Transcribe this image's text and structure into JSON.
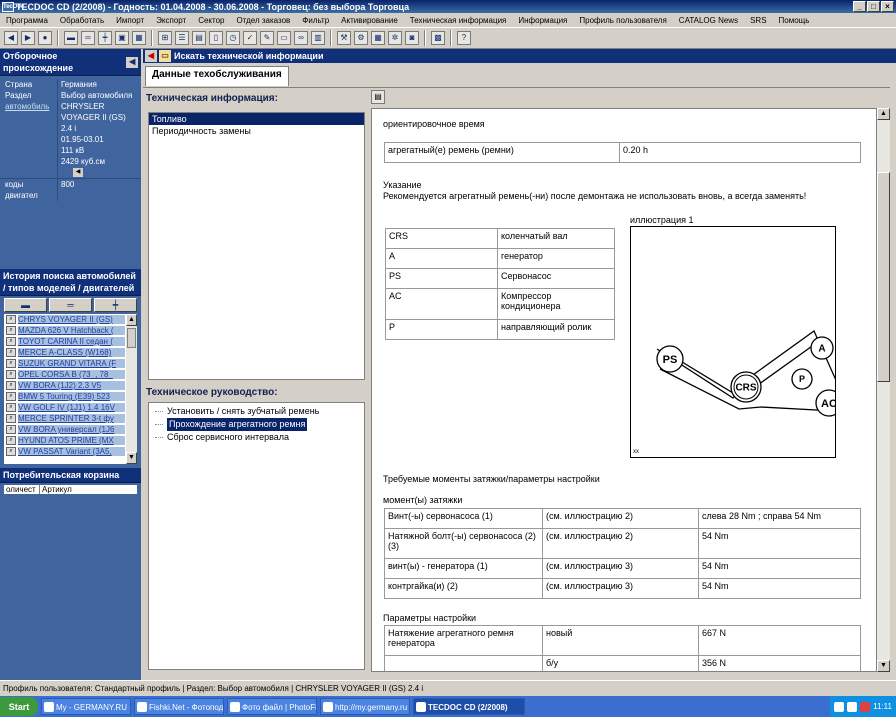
{
  "window": {
    "title": "TECDOC CD (2/2008) - Годность: 01.04.2008 - 30.06.2008 - Торговец: без выбора Торговца",
    "icon_text": "TecDoc"
  },
  "menu": [
    "Программа",
    "Обработать",
    "Импорт",
    "Экспорт",
    "Сектор",
    "Отдел заказов",
    "Фильтр",
    "Активирование",
    "Техническая информация",
    "Информация",
    "Профиль пользователя",
    "CATALOG News",
    "SRS",
    "Помощь"
  ],
  "left": {
    "origin_header": "Отборочное происхождение",
    "kv": [
      {
        "k": "Страна",
        "v": [
          "Германия"
        ]
      },
      {
        "k": "Раздел",
        "v": [
          "Выбор автомобиля"
        ]
      },
      {
        "k": "автомобиль",
        "v": [
          "CHRYSLER",
          "VOYAGER II (GS)",
          "2.4 i",
          "01.95-03.01",
          "111 кВ",
          "2429 куб.см"
        ]
      },
      {
        "k": "коды двигател",
        "v": [
          "800"
        ]
      }
    ],
    "history_header": "История поиска автомобилей / типов моделей / двигателей",
    "history": [
      "CHRYS VOYAGER II (GS)",
      "MAZDA 626 V Hatchback (",
      "TOYOT CARINA II седан (",
      "MERCE A-CLASS (W168)",
      "SUZUK GRAND VITARA (F",
      "OPEL CORSA B (73_, 78_",
      "VW BORA (1J2) 2.3 V5",
      "BMW 5 Touring (E39) 523",
      "VW GOLF IV (1J1) 1.4 16V",
      "MERCE SPRINTER 3-t фу",
      "VW BORA универсал (1J6",
      "HYUND ATOS PRIME (MX",
      "VW PASSAT Variant (3A5,"
    ],
    "basket_header": "Потребительская корзина",
    "basket_cols": [
      "оличест",
      "Артикул"
    ]
  },
  "search_bar": {
    "label": "Искать технической информации"
  },
  "tab": {
    "label": "Данные техобслуживания"
  },
  "mid": {
    "tech_info_label": "Техническая информация:",
    "tech_info_items": [
      "Топливо",
      "Периодичность замены"
    ],
    "tech_guide_label": "Техническое руководство:",
    "tech_guide_items": [
      "Установить / снять зубчатый ремень",
      "Прохождение агрегатного ремня",
      "Сброс сервисного интервала"
    ]
  },
  "content": {
    "approx_time_label": "ориентировочное время",
    "time_row": {
      "name": "агрегатный(е) ремень (ремни)",
      "value": "0.20 h"
    },
    "note_title": "Указание",
    "note_text": "Рекомендуется агрегатный ремень(-ни) после демонтажа не использовать вновь, а всегда заменять!",
    "legend": [
      {
        "code": "CRS",
        "desc": "коленчатый вал"
      },
      {
        "code": "A",
        "desc": "генератор"
      },
      {
        "code": "PS",
        "desc": "Сервонасос"
      },
      {
        "code": "AC",
        "desc": "Компрессор кондиционера"
      },
      {
        "code": "P",
        "desc": "направляющий ролик"
      }
    ],
    "illustration_label": "иллюстрация 1",
    "illustration_foot": "xx",
    "pulleys": {
      "ps": "PS",
      "crs": "CRS",
      "a": "A",
      "p": "P",
      "ac": "AC"
    },
    "torque_header": "Требуемые моменты затяжки/параметры настройки",
    "torque_sub": "момент(ы) затяжки",
    "torque_rows": [
      {
        "name": "Винт(-ы) сервонасоса (1)",
        "ref": "(см. иллюстрацию 2)",
        "value": "слева 28 Nm ; справа 54 Nm"
      },
      {
        "name": "Натяжной болт(-ы) сервонасоса (2) (3)",
        "ref": "(см. иллюстрацию 2)",
        "value": "54 Nm"
      },
      {
        "name": "винт(ы) - генератора (1)",
        "ref": "(см. иллюстрацию 3)",
        "value": "54 Nm"
      },
      {
        "name": "контргайка(и) (2)",
        "ref": "(см. иллюстрацию 3)",
        "value": "54 Nm"
      }
    ],
    "settings_sub": "Параметры настройки",
    "settings_rows": [
      {
        "name": "Натяжение агрегатного ремня генератора",
        "state": "новый",
        "value": "667 N"
      },
      {
        "name": "",
        "state": "б/у",
        "value": "356 N"
      }
    ]
  },
  "status": "Профиль пользователя: Стандартный профиль | Раздел: Выбор автомобиля | CHRYSLER VOYAGER II (GS) 2.4 i",
  "taskbar": {
    "start": "Start",
    "tasks": [
      "My - GERMANY.RU - Гер...",
      "Fishki.Net - Фотоподбор...",
      "Фото файл | PhotoFile.R...",
      "http://my.germany.ru - ...",
      "TECDOC CD (2/2008)"
    ],
    "active_index": 4,
    "clock": "11:11"
  }
}
